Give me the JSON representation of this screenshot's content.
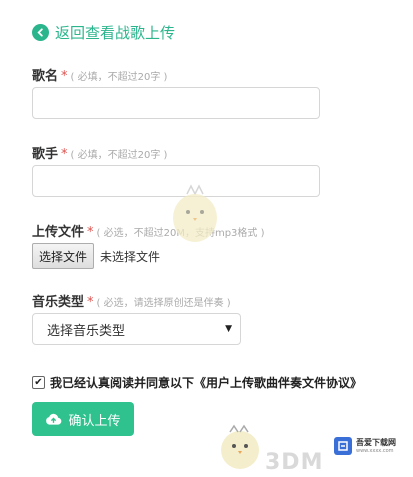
{
  "back_link": {
    "label": "返回查看战歌上传",
    "icon": "chevron-left-circle-icon"
  },
  "fields": {
    "song_name": {
      "label": "歌名",
      "required_mark": "*",
      "hint": "( 必填，不超过20字 )",
      "value": "",
      "placeholder": ""
    },
    "singer": {
      "label": "歌手",
      "required_mark": "*",
      "hint": "( 必填，不超过20字 )",
      "value": "",
      "placeholder": ""
    },
    "upload_file": {
      "label": "上传文件",
      "required_mark": "*",
      "hint": "( 必选，不超过20M，支持mp3格式 )",
      "button_label": "选择文件",
      "status": "未选择文件"
    },
    "music_type": {
      "label": "音乐类型",
      "required_mark": "*",
      "hint": "( 必选，请选择原创还是伴奏 )",
      "selected": "选择音乐类型",
      "arrow": "▼"
    }
  },
  "agreement": {
    "checked": true,
    "check_glyph": "✔",
    "label": "我已经认真阅读并同意以下《用户上传歌曲伴奏文件协议》"
  },
  "submit": {
    "label": "确认上传",
    "icon": "upload-cloud-icon"
  },
  "watermark": {
    "logo_text": "3DM",
    "site_text": "吾爱下载网",
    "site_sub": "www.xxxx.com"
  },
  "colors": {
    "accent": "#2bb58c",
    "button": "#2fc28f",
    "required": "#e0524e",
    "hint": "#aaaaaa"
  }
}
